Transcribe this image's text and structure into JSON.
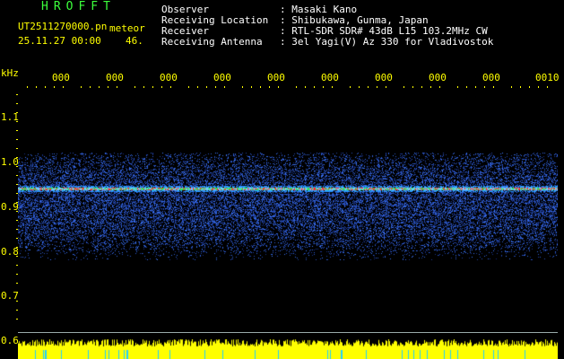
{
  "header": {
    "logo": "HROFFT",
    "filename": "UT2511270000.pn",
    "meteor_label": "meteor",
    "datetime": "25.11.27 00:00",
    "count": "46.",
    "info_labels": [
      "Observer",
      "Receiving Location",
      "Receiver",
      "Receiving Antenna"
    ],
    "info_values": [
      ": Masaki Kano",
      ": Shibukawa, Gunma, Japan",
      ": RTL-SDR SDR# 43dB L15 103.2MHz CW",
      ": 3el Yagi(V) Az 330 for Vladivostok"
    ]
  },
  "axis": {
    "unit_label": "kHz",
    "y_ticks": [
      "1.1",
      "1.0",
      "0.9",
      "0.8",
      "0.7",
      "0.6"
    ],
    "x_ticks": [
      "000",
      "000",
      "000",
      "000",
      "000",
      "000",
      "000",
      "000",
      "000",
      "0010"
    ]
  },
  "colors": {
    "text_yellow": "#ffff00",
    "logo_green": "#3cff3c",
    "signal_blue": "#1e3cff",
    "signal_red": "#ff2020",
    "signal_green": "#20ff60"
  }
}
